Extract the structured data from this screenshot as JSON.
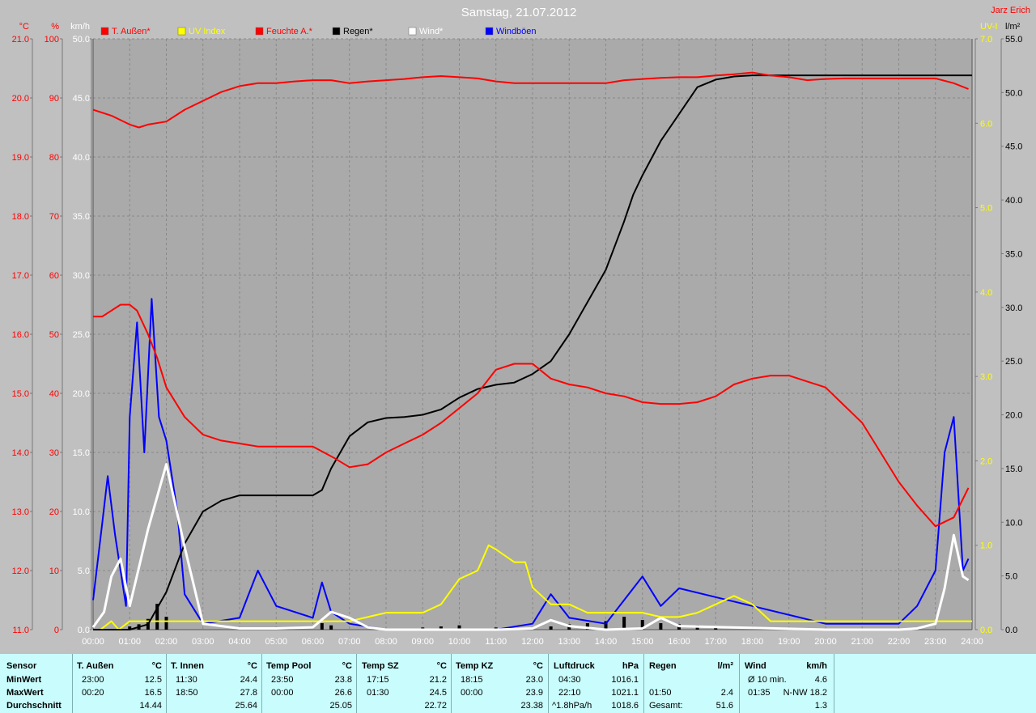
{
  "header": {
    "title": "Samstag, 21.07.2012",
    "author": "Jarz Erich"
  },
  "colors": {
    "temp": "#ff0000",
    "uv": "#ffff00",
    "humidity": "#ff0000",
    "rain": "#000000",
    "wind": "#ffffff",
    "gust": "#0000ff"
  },
  "chart_data": {
    "type": "line",
    "title": "Samstag, 21.07.2012",
    "legend": [
      "T. Außen*",
      "UV Index",
      "Feuchte A.*",
      "Regen*",
      "Wind*",
      "Windböen"
    ],
    "legend_position": "top",
    "grid": true,
    "axes": {
      "left": [
        {
          "unit": "°C",
          "min": 11,
          "max": 21,
          "ticks": [
            "11.0",
            "12.0",
            "13.0",
            "14.0",
            "15.0",
            "16.0",
            "17.0",
            "18.0",
            "19.0",
            "20.0",
            "21.0"
          ]
        },
        {
          "unit": "%",
          "min": 0,
          "max": 100,
          "ticks": [
            "0",
            "10",
            "20",
            "30",
            "40",
            "50",
            "60",
            "70",
            "80",
            "90",
            "100"
          ]
        },
        {
          "unit": "km/h",
          "min": 0,
          "max": 50,
          "ticks": [
            "0.0",
            "5.0",
            "10.0",
            "15.0",
            "20.0",
            "25.0",
            "30.0",
            "35.0",
            "40.0",
            "45.0",
            "50.0"
          ]
        }
      ],
      "right": [
        {
          "unit": "UV-I",
          "min": 0,
          "max": 7,
          "ticks": [
            "0.0",
            "1.0",
            "2.0",
            "3.0",
            "4.0",
            "5.0",
            "6.0",
            "7.0"
          ]
        },
        {
          "unit": "l/m²",
          "min": 0,
          "max": 55,
          "ticks": [
            "0.0",
            "5.0",
            "10.0",
            "15.0",
            "20.0",
            "25.0",
            "30.0",
            "35.0",
            "40.0",
            "45.0",
            "50.0",
            "55.0"
          ]
        }
      ]
    },
    "x_ticks": [
      "00:00",
      "01:00",
      "02:00",
      "03:00",
      "04:00",
      "05:00",
      "06:00",
      "07:00",
      "08:00",
      "09:00",
      "10:00",
      "11:00",
      "12:00",
      "13:00",
      "14:00",
      "15:00",
      "16:00",
      "17:00",
      "18:00",
      "19:00",
      "20:00",
      "21:00",
      "22:00",
      "23:00",
      "24:00"
    ],
    "series": [
      {
        "name": "T. Außen*",
        "axis": "°C",
        "x": [
          0,
          0.25,
          0.5,
          0.75,
          1,
          1.2,
          1.5,
          1.75,
          2,
          2.5,
          3,
          3.5,
          4,
          4.5,
          5,
          5.5,
          6,
          6.3,
          6.6,
          7,
          7.5,
          8,
          8.5,
          9,
          9.5,
          10,
          10.5,
          11,
          11.5,
          12,
          12.5,
          13,
          13.5,
          14,
          14.5,
          15,
          15.5,
          16,
          16.5,
          17,
          17.5,
          18,
          18.5,
          19,
          19.5,
          20,
          20.5,
          21,
          21.5,
          22,
          22.5,
          23,
          23.5,
          23.9
        ],
        "y": [
          16.3,
          16.3,
          16.4,
          16.5,
          16.5,
          16.4,
          16.0,
          15.6,
          15.1,
          14.6,
          14.3,
          14.2,
          14.15,
          14.1,
          14.1,
          14.1,
          14.1,
          14.0,
          13.9,
          13.75,
          13.8,
          14.0,
          14.15,
          14.3,
          14.5,
          14.75,
          15.0,
          15.4,
          15.5,
          15.5,
          15.25,
          15.15,
          15.1,
          15.0,
          14.95,
          14.85,
          14.82,
          14.82,
          14.85,
          14.95,
          15.15,
          15.25,
          15.3,
          15.3,
          15.2,
          15.1,
          14.8,
          14.5,
          14.0,
          13.5,
          13.1,
          12.75,
          12.9,
          13.4
        ]
      },
      {
        "name": "Feuchte A.*",
        "axis": "%",
        "x": [
          0,
          0.5,
          1,
          1.25,
          1.5,
          2,
          2.5,
          3,
          3.5,
          4,
          4.5,
          5,
          5.5,
          6,
          6.5,
          7,
          7.5,
          8,
          8.5,
          9,
          9.5,
          10,
          10.5,
          11,
          11.5,
          12,
          12.5,
          13,
          13.5,
          14,
          14.5,
          15,
          15.5,
          16,
          16.5,
          17,
          17.5,
          18,
          18.5,
          19,
          19.5,
          20,
          20.5,
          21,
          21.5,
          22,
          22.5,
          23,
          23.5,
          23.9
        ],
        "y": [
          88,
          87,
          85.5,
          85,
          85.5,
          86,
          88,
          89.5,
          91,
          92,
          92.5,
          92.5,
          92.8,
          93,
          93,
          92.5,
          92.8,
          93,
          93.2,
          93.5,
          93.7,
          93.5,
          93.3,
          92.8,
          92.5,
          92.5,
          92.5,
          92.5,
          92.5,
          92.5,
          93,
          93.2,
          93.4,
          93.5,
          93.5,
          93.8,
          94,
          94.3,
          93.8,
          93.5,
          93,
          93.2,
          93.3,
          93.3,
          93.3,
          93.3,
          93.3,
          93.3,
          92.5,
          91.5
        ]
      },
      {
        "name": "Regen*",
        "axis": "l/m²",
        "x": [
          0,
          1,
          1.5,
          2,
          2.5,
          3,
          3.5,
          4,
          4.5,
          5,
          5.5,
          6,
          6.25,
          6.5,
          7,
          7.5,
          8,
          8.5,
          9,
          9.5,
          10,
          10.5,
          11,
          11.5,
          12,
          12.5,
          13,
          13.5,
          14,
          14.5,
          14.75,
          15,
          15.5,
          16,
          16.5,
          17,
          17.5,
          18,
          18.5,
          24
        ],
        "y": [
          0,
          0,
          0.5,
          3.5,
          8,
          11,
          12,
          12.5,
          12.5,
          12.5,
          12.5,
          12.5,
          13,
          15,
          18,
          19.3,
          19.7,
          19.8,
          20.0,
          20.5,
          21.6,
          22.4,
          22.8,
          23.0,
          23.8,
          25,
          27.5,
          30.5,
          33.5,
          38,
          40.5,
          42.3,
          45.5,
          48,
          50.5,
          51.2,
          51.5,
          51.6,
          51.6,
          51.6
        ]
      },
      {
        "name": "UV Index",
        "axis": "UV-I",
        "x": [
          0,
          0.2,
          0.5,
          0.7,
          1,
          2,
          3,
          4,
          5,
          6,
          7,
          7.5,
          8,
          8.5,
          9,
          9.5,
          10,
          10.5,
          10.8,
          11,
          11.5,
          11.8,
          12,
          12.5,
          13,
          13.5,
          14,
          14.5,
          15,
          15.5,
          16,
          16.5,
          17,
          17.5,
          18,
          18.5,
          19,
          20,
          24
        ],
        "y": [
          0,
          0,
          0.1,
          0,
          0.1,
          0.1,
          0.1,
          0.1,
          0.1,
          0.1,
          0.1,
          0.15,
          0.2,
          0.2,
          0.2,
          0.3,
          0.6,
          0.7,
          1.0,
          0.95,
          0.8,
          0.8,
          0.5,
          0.3,
          0.3,
          0.2,
          0.2,
          0.2,
          0.2,
          0.15,
          0.15,
          0.2,
          0.3,
          0.4,
          0.3,
          0.1,
          0.1,
          0.1,
          0.1
        ]
      },
      {
        "name": "Wind*",
        "axis": "km/h",
        "x": [
          0,
          0.3,
          0.5,
          0.75,
          1,
          1.5,
          2,
          2.5,
          3,
          4,
          5,
          6,
          6.5,
          7,
          7.5,
          8,
          11,
          12,
          12.5,
          13,
          14,
          15,
          15.5,
          16,
          20,
          22,
          22.5,
          23,
          23.25,
          23.5,
          23.75,
          23.9
        ],
        "y": [
          0.2,
          1.5,
          4.5,
          6.0,
          2.0,
          8.5,
          14.0,
          7.0,
          0.5,
          0.1,
          0.1,
          0.2,
          1.5,
          1.0,
          0.2,
          0,
          0,
          0.1,
          0.8,
          0.3,
          0,
          0.1,
          1.0,
          0.3,
          0,
          0,
          0.1,
          0.5,
          3.5,
          8.0,
          4.5,
          4.2
        ]
      },
      {
        "name": "Windböen",
        "axis": "km/h",
        "x": [
          0,
          0.25,
          0.4,
          0.6,
          0.9,
          1,
          1.2,
          1.4,
          1.6,
          1.8,
          2,
          2.3,
          2.5,
          3,
          4,
          4.5,
          5,
          6,
          6.25,
          6.5,
          7,
          8,
          11,
          12,
          12.5,
          13,
          14,
          15,
          15.5,
          16,
          20,
          22,
          22.5,
          23,
          23.25,
          23.5,
          23.75,
          23.9
        ],
        "y": [
          2.5,
          9.0,
          13.0,
          8.0,
          2.0,
          18.0,
          26.0,
          15.0,
          28.0,
          18.0,
          16.0,
          10.0,
          3.0,
          0.5,
          1.0,
          5.0,
          2.0,
          1.0,
          4.0,
          1.5,
          0.5,
          0,
          0,
          0.5,
          3.0,
          1.0,
          0.5,
          4.5,
          2.0,
          3.5,
          0.5,
          0.5,
          2.0,
          5.0,
          15.0,
          18.0,
          5.0,
          6.0
        ]
      }
    ],
    "rain_bars": {
      "name": "Regen (Intervall)",
      "x": [
        1.0,
        1.25,
        1.5,
        1.75,
        2.0,
        6.25,
        6.5,
        9.0,
        9.5,
        10.0,
        11.0,
        12.5,
        13.0,
        13.5,
        14.0,
        14.5,
        15.0,
        15.5,
        16.0,
        16.5,
        17.0
      ],
      "y": [
        0.3,
        0.5,
        1.0,
        2.4,
        1.2,
        0.6,
        0.4,
        0.2,
        0.3,
        0.4,
        0.2,
        0.3,
        0.5,
        0.6,
        0.8,
        1.2,
        0.9,
        0.6,
        0.5,
        0.4,
        0.2
      ]
    }
  },
  "table": {
    "header_row": [
      "Sensor",
      "T. Außen",
      "°C",
      "T. Innen",
      "°C",
      "Temp Pool",
      "°C",
      "Temp SZ",
      "°C",
      "Temp KZ",
      "°C",
      "Luftdruck",
      "hPa",
      "Regen",
      "l/m²",
      "Wind",
      "km/h"
    ],
    "rows": [
      {
        "label": "MinWert",
        "t_aussen": [
          "23:00",
          "12.5"
        ],
        "t_innen": [
          "11:30",
          "24.4"
        ],
        "pool": [
          "23:50",
          "23.8"
        ],
        "sz": [
          "17:15",
          "21.2"
        ],
        "kz": [
          "18:15",
          "23.0"
        ],
        "luftdruck": [
          "04:30",
          "1016.1"
        ],
        "regen": [
          "",
          ""
        ],
        "wind": [
          "Ø 10 min.",
          "4.6"
        ]
      },
      {
        "label": "MaxWert",
        "t_aussen": [
          "00:20",
          "16.5"
        ],
        "t_innen": [
          "18:50",
          "27.8"
        ],
        "pool": [
          "00:00",
          "26.6"
        ],
        "sz": [
          "01:30",
          "24.5"
        ],
        "kz": [
          "00:00",
          "23.9"
        ],
        "luftdruck": [
          "22:10",
          "1021.1"
        ],
        "regen": [
          "01:50",
          "2.4"
        ],
        "wind": [
          "01:35",
          "N-NW 18.2"
        ]
      },
      {
        "label": "Durchschnitt",
        "t_aussen": [
          "",
          "14.44"
        ],
        "t_innen": [
          "",
          "25.64"
        ],
        "pool": [
          "",
          "25.05"
        ],
        "sz": [
          "",
          "22.72"
        ],
        "kz": [
          "",
          "23.38"
        ],
        "luftdruck": [
          "^1.8hPa/h",
          "1018.6"
        ],
        "regen": [
          "Gesamt:",
          "51.6"
        ],
        "wind": [
          "",
          "1.3"
        ]
      }
    ]
  }
}
